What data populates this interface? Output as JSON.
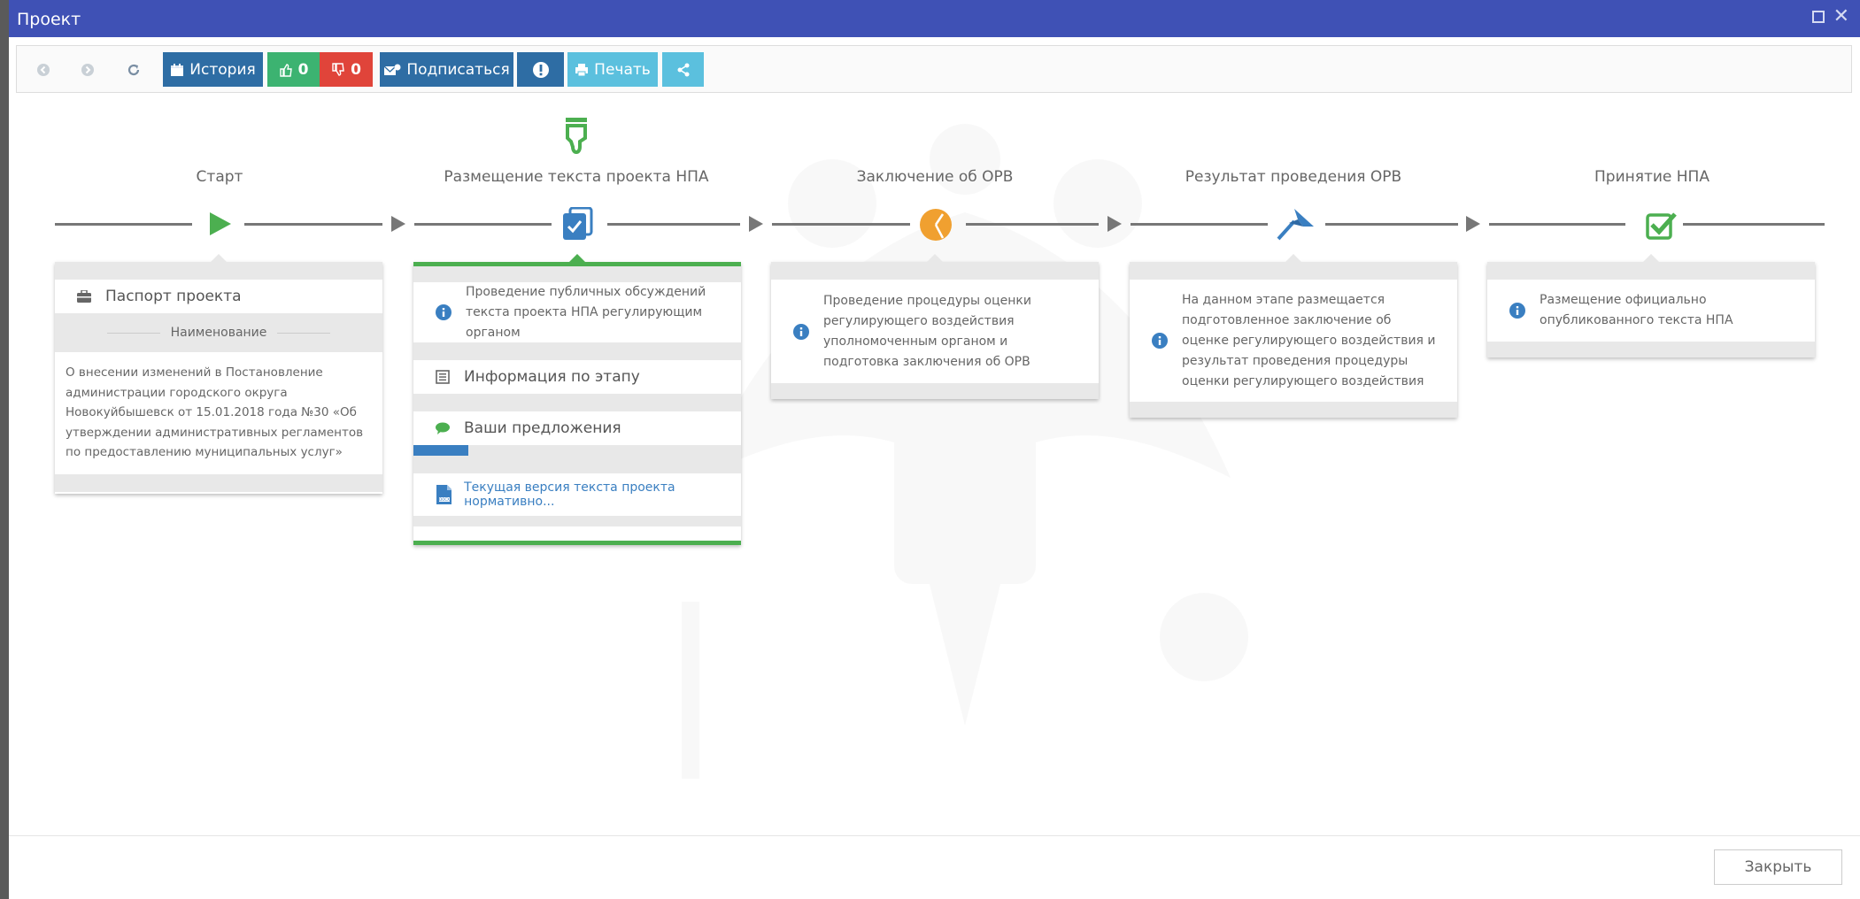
{
  "window": {
    "title": "Проект"
  },
  "toolbar": {
    "history_label": "История",
    "likes": "0",
    "dislikes": "0",
    "subscribe_label": "Подписаться",
    "print_label": "Печать"
  },
  "stages": [
    {
      "title": "Старт",
      "icon": "play-icon",
      "color": "#4caf50"
    },
    {
      "title": "Размещение текста проекта НПА",
      "icon": "document-check-icon",
      "color": "#3a7fc1"
    },
    {
      "title": "Заключение об ОРВ",
      "icon": "pie-icon",
      "color": "#f0a030"
    },
    {
      "title": "Результат проведения ОРВ",
      "icon": "pin-icon",
      "color": "#3a7fc1"
    },
    {
      "title": "Принятие НПА",
      "icon": "checkbox-icon",
      "color": "#4caf50"
    }
  ],
  "passport": {
    "header": "Паспорт проекта",
    "name_label": "Наименование",
    "name_value": "О внесении изменений в Постановление администрации городского округа Новокуйбышевск от 15.01.2018 года №30 «Об утверждении административных регламентов по предоставлению муниципальных услуг»"
  },
  "active_stage": {
    "description": "Проведение публичных обсуждений текста проекта НПА регулирующим органом",
    "info_label": "Информация по этапу",
    "proposals_label": "Ваши предложения",
    "document_link": "Текущая версия текста проекта нормативно..."
  },
  "stage_descriptions": {
    "orv_conclusion": "Проведение процедуры оценки регулирующего воздействия уполномоченным органом и подготовка заключения об ОРВ",
    "orv_result": "На данном этапе размещается подготовленное заключение об оценке регулирующего воздействия и результат проведения процедуры оценки регулирующего воздействия",
    "npa_adoption": "Размещение официально опубликованного текста НПА"
  },
  "footer": {
    "close_label": "Закрыть"
  },
  "colors": {
    "titlebar": "#3f51b5",
    "primary": "#2e6da4",
    "success": "#3cb371",
    "danger": "#e0443a",
    "info": "#5bc0de",
    "stage_active": "#4caf50"
  }
}
